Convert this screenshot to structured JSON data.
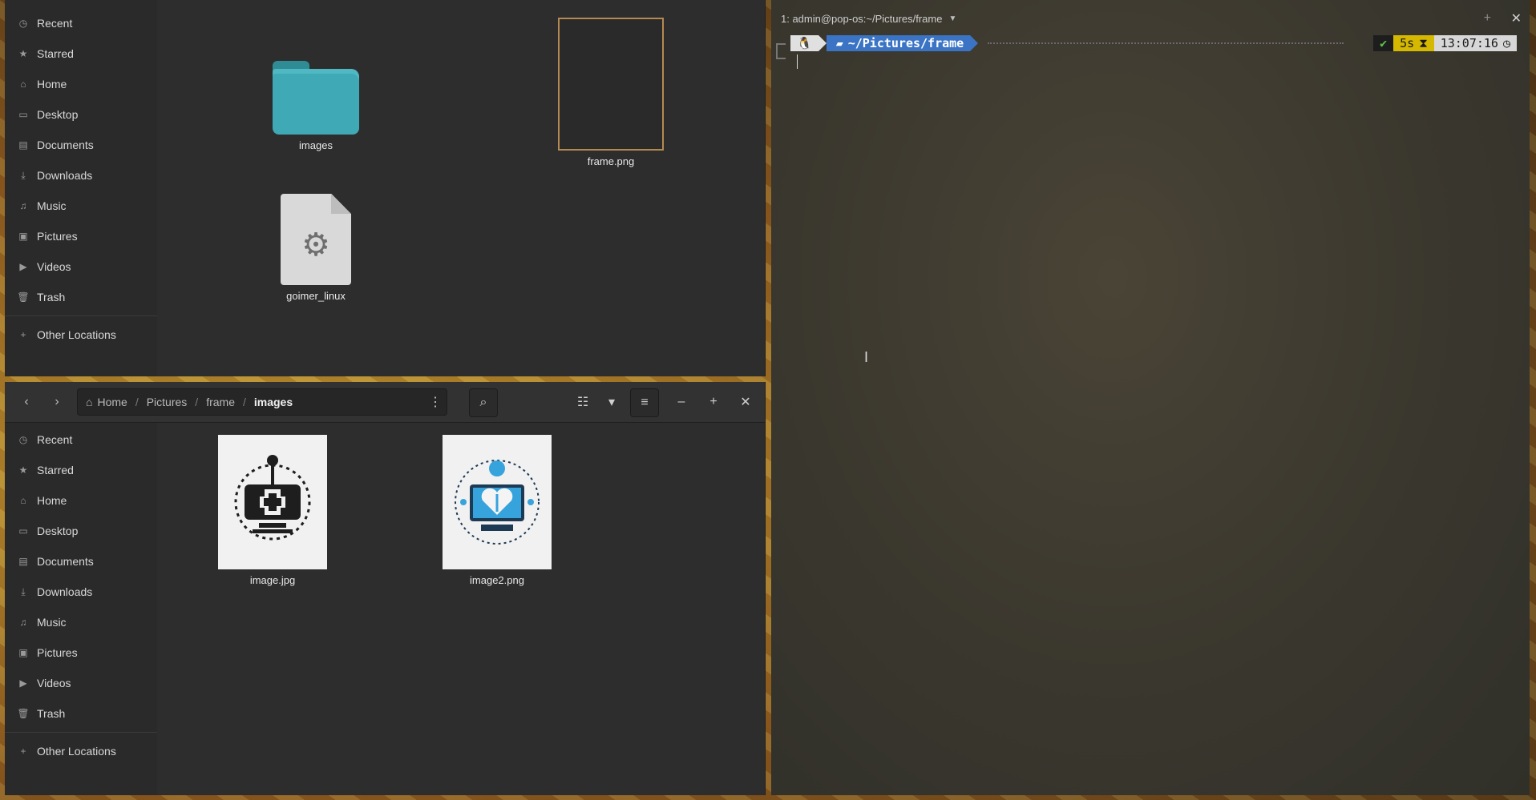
{
  "sidebar": {
    "items": [
      {
        "label": "Recent",
        "icon": "clock-icon"
      },
      {
        "label": "Starred",
        "icon": "star-icon"
      },
      {
        "label": "Home",
        "icon": "home-icon"
      },
      {
        "label": "Desktop",
        "icon": "desktop-icon"
      },
      {
        "label": "Documents",
        "icon": "document-icon"
      },
      {
        "label": "Downloads",
        "icon": "download-icon"
      },
      {
        "label": "Music",
        "icon": "music-icon"
      },
      {
        "label": "Pictures",
        "icon": "picture-icon"
      },
      {
        "label": "Videos",
        "icon": "video-icon"
      },
      {
        "label": "Trash",
        "icon": "trash-icon"
      }
    ],
    "other_locations": "Other Locations"
  },
  "top_window": {
    "files": [
      {
        "name": "images",
        "type": "folder"
      },
      {
        "name": "frame.png",
        "type": "image"
      },
      {
        "name": "goimer_linux",
        "type": "executable"
      }
    ]
  },
  "bottom_window": {
    "breadcrumb": [
      "Home",
      "Pictures",
      "frame",
      "images"
    ],
    "files": [
      {
        "name": "image.jpg",
        "type": "image"
      },
      {
        "name": "image2.png",
        "type": "image"
      }
    ]
  },
  "terminal": {
    "tab_title": "1: admin@pop-os:~/Pictures/frame",
    "prompt_path": "~/Pictures/frame",
    "status_ok": "✔",
    "duration": "5s",
    "time": "13:07:16"
  },
  "colors": {
    "folder": "#3fa9b5",
    "prompt_dir": "#3b74c4",
    "duration_bg": "#d5b800"
  }
}
